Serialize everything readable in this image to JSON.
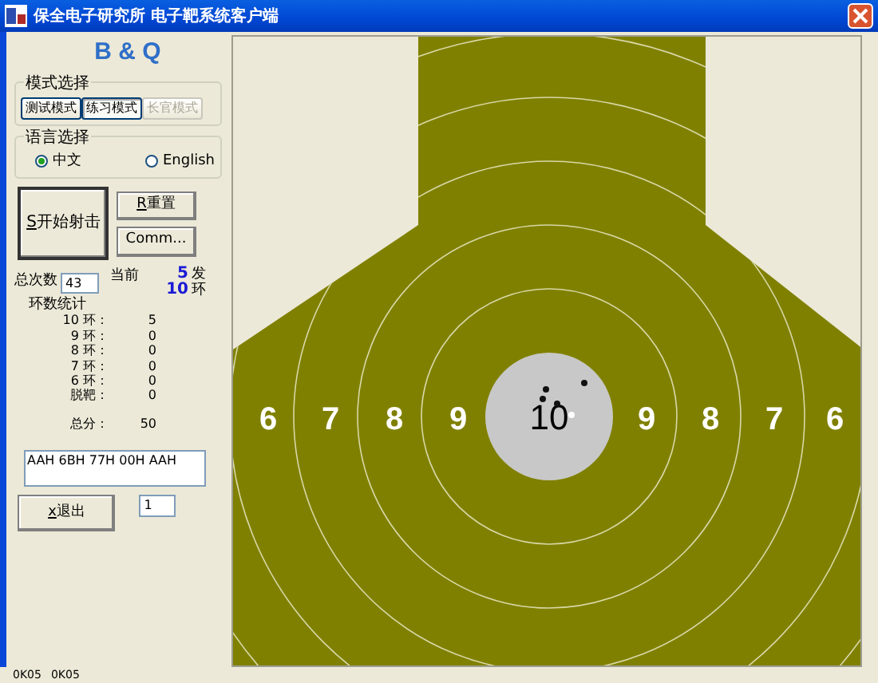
{
  "window": {
    "title": "保全电子研究所  电子靶系统客户端"
  },
  "logo": "B & Q",
  "mode_group": {
    "title": "模式选择",
    "buttons": [
      {
        "label": "测试模式",
        "selected": false,
        "disabled": false
      },
      {
        "label": "练习模式",
        "selected": true,
        "disabled": false
      },
      {
        "label": "长官模式",
        "selected": false,
        "disabled": true
      }
    ]
  },
  "language_group": {
    "title": "语言选择",
    "options": [
      {
        "label": "中文",
        "selected": true
      },
      {
        "label": "English",
        "selected": false
      }
    ]
  },
  "start_button": {
    "mnemonic": "S",
    "label": "开始射击"
  },
  "reset_button": {
    "mnemonic": "R",
    "label": "重置"
  },
  "comm_button": {
    "label": "Comm..."
  },
  "total_count": {
    "label": "总次数",
    "value": "43"
  },
  "current": {
    "label": "当前",
    "shots": "5",
    "shots_unit": "发",
    "rings": "10",
    "rings_unit": "环"
  },
  "stats": {
    "title": "环数统计",
    "rows": [
      {
        "label": "10 环：",
        "value": "5"
      },
      {
        "label": "9 环：",
        "value": "0"
      },
      {
        "label": "8 环：",
        "value": "0"
      },
      {
        "label": "7 环：",
        "value": "0"
      },
      {
        "label": "6 环：",
        "value": "0"
      },
      {
        "label": "脱靶：",
        "value": "0"
      }
    ],
    "total_label": "总分：",
    "total_value": "50"
  },
  "data_box": {
    "value": "AAH 6BH 77H 00H AAH"
  },
  "exit_button": {
    "mnemonic": "x",
    "label": "退出"
  },
  "port_field": {
    "value": "1"
  },
  "target": {
    "labels": [
      "6",
      "7",
      "8",
      "9",
      "10",
      "9",
      "8",
      "7",
      "6"
    ]
  },
  "taskbar": [
    "0K05",
    "0K05"
  ]
}
